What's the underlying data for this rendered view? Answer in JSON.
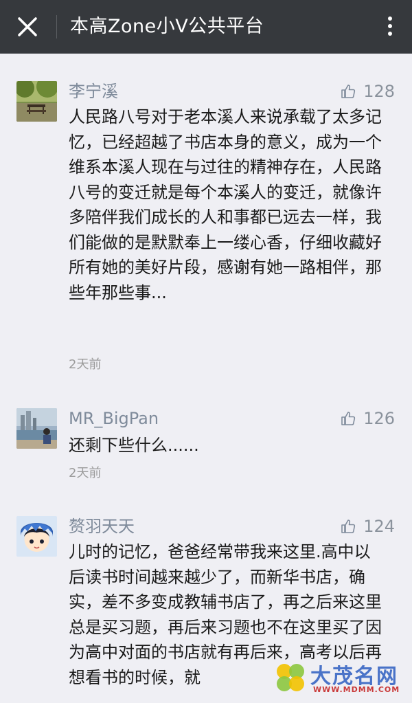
{
  "header": {
    "title": "本高Zone小V公共平台"
  },
  "comments": [
    {
      "author": "李宁溪",
      "likes": "128",
      "text": "人民路八号对于老本溪人来说承载了太多记忆，已经超越了书店本身的意义，成为一个维系本溪人现在与过往的精神存在，人民路八号的变迁就是每个本溪人的变迁，就像许多陪伴我们成长的人和事都已远去一样，我们能做的是默默奉上一缕心香，仔细收藏好所有她的美好片段，感谢有她一路相伴，那些年那些事...",
      "time": "2天前"
    },
    {
      "author": "MR_BigPan",
      "likes": "126",
      "text": "还剩下些什么......",
      "time": "2天前"
    },
    {
      "author": "赘羽天天",
      "likes": "124",
      "text": "儿时的记忆，爸爸经常带我来这里.高中以后读书时间越来越少了，而新华书店，确实，差不多变成教辅书店了，再之后来这里总是买习题，再后来习题也不在这里买了因为高中对面的书店就有再后来，高考以后再想看书的时候，就"
    }
  ],
  "watermark": {
    "text": "大茂名网",
    "sub": "WWW.MDMM.COM"
  },
  "colors": {
    "topbar": "#36393d",
    "background": "#efeff4",
    "author": "#7f8b9b",
    "text": "#1a1a1a",
    "meta": "#9b9b9b"
  }
}
